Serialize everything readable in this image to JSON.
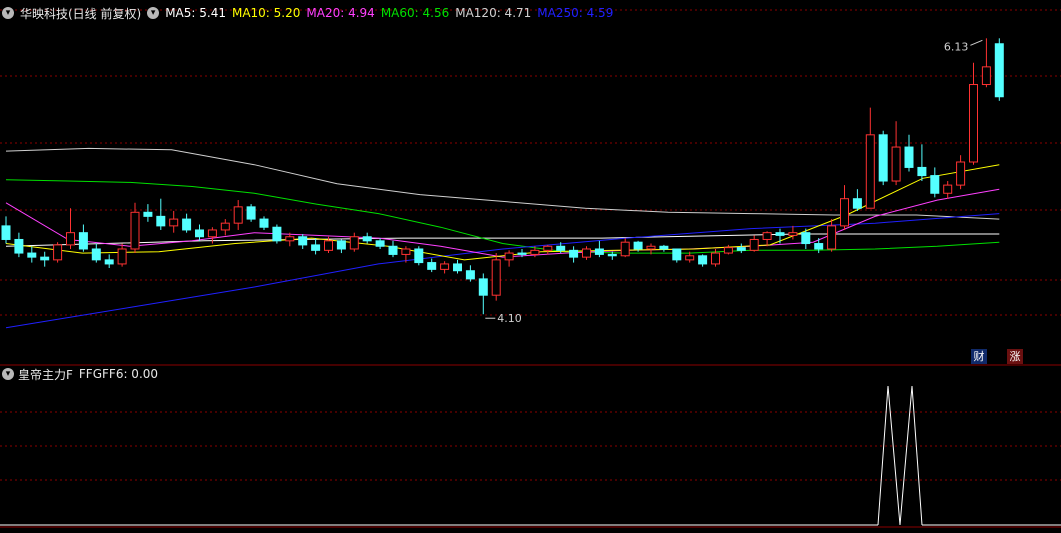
{
  "header": {
    "stock_title": "华映科技(日线 前复权)",
    "ma_items": [
      {
        "text": "MA5: 5.41",
        "color": "#ffffff"
      },
      {
        "text": "MA10: 5.20",
        "color": "#ffff00"
      },
      {
        "text": "MA20: 4.94",
        "color": "#ff40ff"
      },
      {
        "text": "MA60: 4.56",
        "color": "#00e000"
      },
      {
        "text": "MA120: 4.71",
        "color": "#d0d0d0"
      },
      {
        "text": "MA250: 4.59",
        "color": "#2020ff"
      }
    ]
  },
  "badges": {
    "cai": "财",
    "zhang": "涨"
  },
  "indicator": {
    "name": "皇帝主力F",
    "value_text": "FFGFF6: 0.00"
  },
  "colors": {
    "up": "#ff3232",
    "down": "#54ffff",
    "grid": "#8b0000",
    "panel_border": "#8b0000"
  },
  "chart_data": [
    {
      "type": "candlestick",
      "title": "华映科技(日线 前复权)",
      "high_label": "6.13",
      "low_label": "4.10",
      "ohlc": [
        [
          4.75,
          4.82,
          4.62,
          4.65
        ],
        [
          4.65,
          4.7,
          4.52,
          4.55
        ],
        [
          4.55,
          4.6,
          4.48,
          4.52
        ],
        [
          4.52,
          4.56,
          4.45,
          4.5
        ],
        [
          4.5,
          4.63,
          4.48,
          4.61
        ],
        [
          4.61,
          4.88,
          4.58,
          4.7
        ],
        [
          4.7,
          4.76,
          4.56,
          4.58
        ],
        [
          4.58,
          4.62,
          4.48,
          4.5
        ],
        [
          4.5,
          4.54,
          4.44,
          4.47
        ],
        [
          4.47,
          4.62,
          4.45,
          4.58
        ],
        [
          4.58,
          4.92,
          4.55,
          4.85
        ],
        [
          4.85,
          4.91,
          4.78,
          4.82
        ],
        [
          4.82,
          4.95,
          4.72,
          4.75
        ],
        [
          4.75,
          4.86,
          4.7,
          4.8
        ],
        [
          4.8,
          4.84,
          4.7,
          4.72
        ],
        [
          4.72,
          4.76,
          4.64,
          4.67
        ],
        [
          4.67,
          4.74,
          4.62,
          4.72
        ],
        [
          4.72,
          4.8,
          4.68,
          4.77
        ],
        [
          4.77,
          4.94,
          4.72,
          4.89
        ],
        [
          4.89,
          4.91,
          4.78,
          4.8
        ],
        [
          4.8,
          4.82,
          4.72,
          4.74
        ],
        [
          4.74,
          4.76,
          4.62,
          4.64
        ],
        [
          4.64,
          4.7,
          4.6,
          4.67
        ],
        [
          4.67,
          4.69,
          4.58,
          4.61
        ],
        [
          4.61,
          4.66,
          4.54,
          4.57
        ],
        [
          4.57,
          4.67,
          4.55,
          4.64
        ],
        [
          4.64,
          4.65,
          4.55,
          4.58
        ],
        [
          4.58,
          4.7,
          4.56,
          4.67
        ],
        [
          4.67,
          4.7,
          4.62,
          4.64
        ],
        [
          4.64,
          4.66,
          4.58,
          4.6
        ],
        [
          4.6,
          4.64,
          4.52,
          4.54
        ],
        [
          4.54,
          4.6,
          4.48,
          4.58
        ],
        [
          4.58,
          4.6,
          4.46,
          4.48
        ],
        [
          4.48,
          4.51,
          4.41,
          4.43
        ],
        [
          4.43,
          4.49,
          4.4,
          4.47
        ],
        [
          4.47,
          4.5,
          4.4,
          4.42
        ],
        [
          4.42,
          4.46,
          4.34,
          4.36
        ],
        [
          4.36,
          4.4,
          4.1,
          4.24
        ],
        [
          4.24,
          4.55,
          4.2,
          4.5
        ],
        [
          4.5,
          4.57,
          4.45,
          4.55
        ],
        [
          4.55,
          4.58,
          4.52,
          4.54
        ],
        [
          4.54,
          4.6,
          4.52,
          4.57
        ],
        [
          4.57,
          4.61,
          4.54,
          4.6
        ],
        [
          4.6,
          4.63,
          4.55,
          4.57
        ],
        [
          4.57,
          4.6,
          4.48,
          4.52
        ],
        [
          4.52,
          4.6,
          4.5,
          4.58
        ],
        [
          4.58,
          4.64,
          4.52,
          4.54
        ],
        [
          4.54,
          4.56,
          4.5,
          4.53
        ],
        [
          4.53,
          4.66,
          4.52,
          4.63
        ],
        [
          4.63,
          4.64,
          4.56,
          4.58
        ],
        [
          4.58,
          4.62,
          4.54,
          4.6
        ],
        [
          4.6,
          4.61,
          4.56,
          4.58
        ],
        [
          4.58,
          4.58,
          4.48,
          4.5
        ],
        [
          4.5,
          4.56,
          4.48,
          4.53
        ],
        [
          4.53,
          4.54,
          4.45,
          4.47
        ],
        [
          4.47,
          4.58,
          4.45,
          4.55
        ],
        [
          4.55,
          4.61,
          4.54,
          4.59
        ],
        [
          4.59,
          4.62,
          4.55,
          4.57
        ],
        [
          4.57,
          4.68,
          4.56,
          4.65
        ],
        [
          4.65,
          4.71,
          4.6,
          4.7
        ],
        [
          4.7,
          4.73,
          4.62,
          4.68
        ],
        [
          4.68,
          4.75,
          4.65,
          4.7
        ],
        [
          4.7,
          4.73,
          4.58,
          4.62
        ],
        [
          4.62,
          4.66,
          4.55,
          4.58
        ],
        [
          4.58,
          4.8,
          4.56,
          4.75
        ],
        [
          4.75,
          5.05,
          4.72,
          4.95
        ],
        [
          4.95,
          5.02,
          4.86,
          4.88
        ],
        [
          4.88,
          5.62,
          4.88,
          5.42
        ],
        [
          5.42,
          5.45,
          5.05,
          5.08
        ],
        [
          5.08,
          5.52,
          5.05,
          5.33
        ],
        [
          5.33,
          5.42,
          5.15,
          5.18
        ],
        [
          5.18,
          5.35,
          5.08,
          5.12
        ],
        [
          5.12,
          5.18,
          4.96,
          4.99
        ],
        [
          4.99,
          5.08,
          4.95,
          5.05
        ],
        [
          5.05,
          5.27,
          5.02,
          5.22
        ],
        [
          5.22,
          5.95,
          5.2,
          5.79
        ],
        [
          5.79,
          6.13,
          5.77,
          5.92
        ],
        [
          6.09,
          6.13,
          5.67,
          5.7
        ]
      ],
      "ma_series": [
        {
          "name": "MA5",
          "color": "#ffffff",
          "values": [
            4.6,
            4.64,
            4.66,
            4.66,
            4.69,
            4.69
          ]
        },
        {
          "name": "MA120",
          "color": "#d0d0d0",
          "values": [
            5.3,
            5.32,
            5.31,
            5.2,
            5.06,
            4.98,
            4.93,
            4.88,
            4.85,
            4.84,
            4.83,
            4.83,
            4.8
          ]
        },
        {
          "name": "MA60",
          "color": "#00e000",
          "values": [
            5.09,
            5.08,
            5.07,
            5.04,
            4.99,
            4.91,
            4.84,
            4.74,
            4.62,
            4.56,
            4.55,
            4.55,
            4.57,
            4.57,
            4.58,
            4.6,
            4.63
          ]
        },
        {
          "name": "MA250",
          "color": "#2020ff",
          "values": [
            4.0,
            4.15,
            4.3,
            4.47,
            4.58,
            4.66,
            4.73,
            4.77,
            4.84
          ]
        },
        {
          "name": "MA20",
          "color": "#ff40ff",
          "values": [
            4.92,
            4.65,
            4.6,
            4.64,
            4.7,
            4.68,
            4.66,
            4.6,
            4.52,
            4.55,
            4.57,
            4.58,
            4.6,
            4.63,
            4.82,
            4.94,
            5.02
          ]
        },
        {
          "name": "MA10",
          "color": "#ffff00",
          "values": [
            4.62,
            4.55,
            4.56,
            4.62,
            4.66,
            4.6,
            4.5,
            4.56,
            4.57,
            4.58,
            4.61,
            4.83,
            5.1,
            5.2
          ]
        }
      ]
    },
    {
      "type": "line",
      "title": "皇帝主力F",
      "series": [
        {
          "name": "FFGFF6",
          "color": "#ffffff",
          "values": [
            0,
            1,
            0,
            1,
            0
          ]
        }
      ]
    }
  ]
}
